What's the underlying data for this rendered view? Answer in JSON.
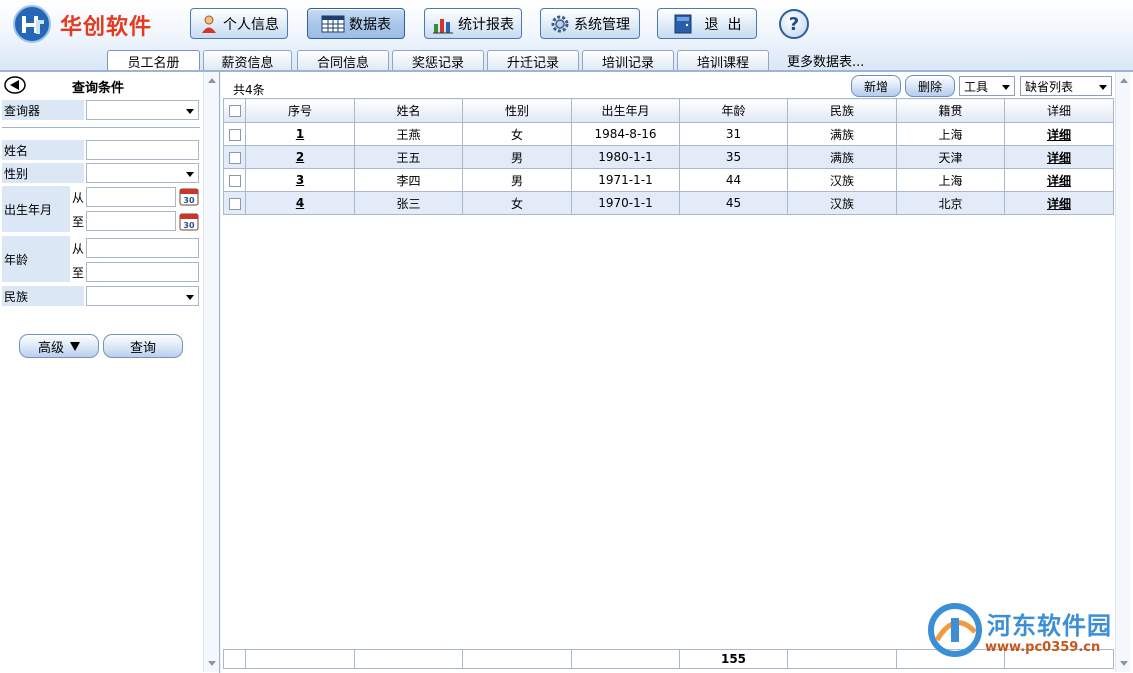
{
  "app": {
    "name": "华创软件"
  },
  "toolbar": [
    {
      "label": "个人信息",
      "icon": "user-icon",
      "active": false
    },
    {
      "label": "数据表",
      "icon": "table-icon",
      "active": true
    },
    {
      "label": "统计报表",
      "icon": "chart-icon",
      "active": false
    },
    {
      "label": "系统管理",
      "icon": "gear-icon",
      "active": false
    },
    {
      "label": "退  出",
      "icon": "exit-icon",
      "active": false
    }
  ],
  "help": {
    "label": "?"
  },
  "tabs": [
    {
      "label": "员工名册",
      "active": true
    },
    {
      "label": "薪资信息"
    },
    {
      "label": "合同信息"
    },
    {
      "label": "奖惩记录"
    },
    {
      "label": "升迁记录"
    },
    {
      "label": "培训记录"
    },
    {
      "label": "培训课程"
    },
    {
      "label": "更多数据表..."
    }
  ],
  "query": {
    "title": "查询条件",
    "labels": {
      "query_tool": "查询器",
      "name": "姓名",
      "gender": "性别",
      "birth": "出生年月",
      "age": "年龄",
      "ethnicity": "民族",
      "from": "从",
      "to": "至"
    },
    "values": {
      "query_tool": "",
      "name": "",
      "gender": "",
      "birth_from": "",
      "birth_to": "",
      "age_from": "",
      "age_to": "",
      "ethnicity": ""
    },
    "calendar_badge": "30",
    "advanced_label": "高级",
    "search_label": "查询"
  },
  "grid": {
    "count_label": "共4条",
    "add_label": "新增",
    "delete_label": "删除",
    "tools_label": "工具",
    "view_label": "缺省列表",
    "columns": [
      "序号",
      "姓名",
      "性别",
      "出生年月",
      "年龄",
      "民族",
      "籍贯",
      "详细"
    ],
    "rows": [
      {
        "seq": "1",
        "name": "王燕",
        "gender": "女",
        "birth": "1984-8-16",
        "age": "31",
        "ethnicity": "满族",
        "origin": "上海",
        "detail": "详细"
      },
      {
        "seq": "2",
        "name": "王五",
        "gender": "男",
        "birth": "1980-1-1",
        "age": "35",
        "ethnicity": "满族",
        "origin": "天津",
        "detail": "详细"
      },
      {
        "seq": "3",
        "name": "李四",
        "gender": "男",
        "birth": "1971-1-1",
        "age": "44",
        "ethnicity": "汉族",
        "origin": "上海",
        "detail": "详细"
      },
      {
        "seq": "4",
        "name": "张三",
        "gender": "女",
        "birth": "1970-1-1",
        "age": "45",
        "ethnicity": "汉族",
        "origin": "北京",
        "detail": "详细"
      }
    ],
    "footer": {
      "age_total": "155"
    }
  },
  "watermark": {
    "title": "河东软件园",
    "url": "www.pc0359.cn"
  },
  "colors": {
    "brand": "#e43a1f",
    "accent": "#3c8fd6",
    "row_alt": "#e3ebf8"
  }
}
